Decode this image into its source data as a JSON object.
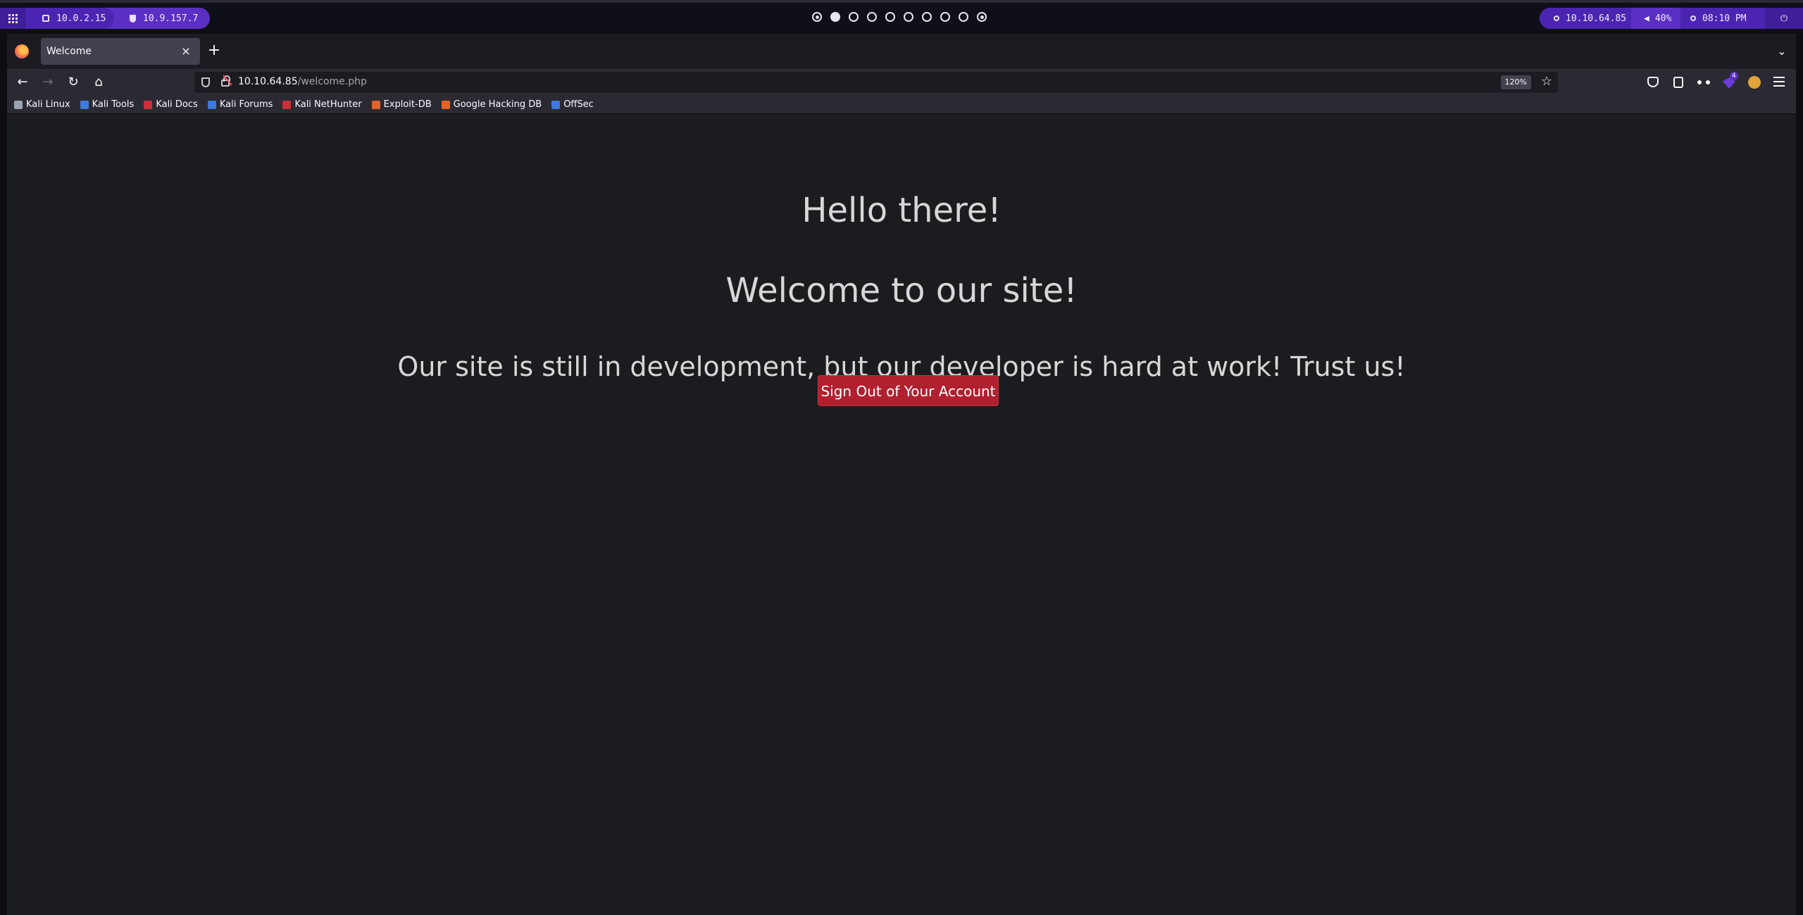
{
  "desktop_bar": {
    "left": {
      "local_ip": "10.0.2.15",
      "vpn_ip": "10.9.157.7"
    },
    "workspaces": [
      {
        "state": "ring"
      },
      {
        "state": "active"
      },
      {
        "state": "empty"
      },
      {
        "state": "empty"
      },
      {
        "state": "empty"
      },
      {
        "state": "empty"
      },
      {
        "state": "empty"
      },
      {
        "state": "empty"
      },
      {
        "state": "empty"
      },
      {
        "state": "ring"
      }
    ],
    "right": {
      "target_ip": "10.10.64.85",
      "volume": "40%",
      "time": "08:10 PM"
    }
  },
  "browser": {
    "tab": {
      "title": "Welcome",
      "close": "×"
    },
    "new_tab": "+",
    "url": {
      "host": "10.10.64.85",
      "path": "/welcome.php"
    },
    "zoom": "120%",
    "extension_badge": "4",
    "bookmarks": [
      {
        "label": "Kali Linux",
        "color": "#9aa5b1"
      },
      {
        "label": "Kali Tools",
        "color": "#3d7bd9"
      },
      {
        "label": "Kali Docs",
        "color": "#c9303a"
      },
      {
        "label": "Kali Forums",
        "color": "#3d7bd9"
      },
      {
        "label": "Kali NetHunter",
        "color": "#c9303a"
      },
      {
        "label": "Exploit-DB",
        "color": "#e2622b"
      },
      {
        "label": "Google Hacking DB",
        "color": "#e2622b"
      },
      {
        "label": "OffSec",
        "color": "#3d7bd9"
      }
    ]
  },
  "page": {
    "greeting": "Hello there!",
    "welcome": "Welcome to our site!",
    "dev_notice": "Our site is still in development, but our developer is hard at work! Trust us!",
    "signout_label": "Sign Out of Your Account"
  },
  "colors": {
    "accent_purple": "#5b2fc4",
    "page_bg": "#1b1c1f",
    "button_red": "#b1202f"
  }
}
